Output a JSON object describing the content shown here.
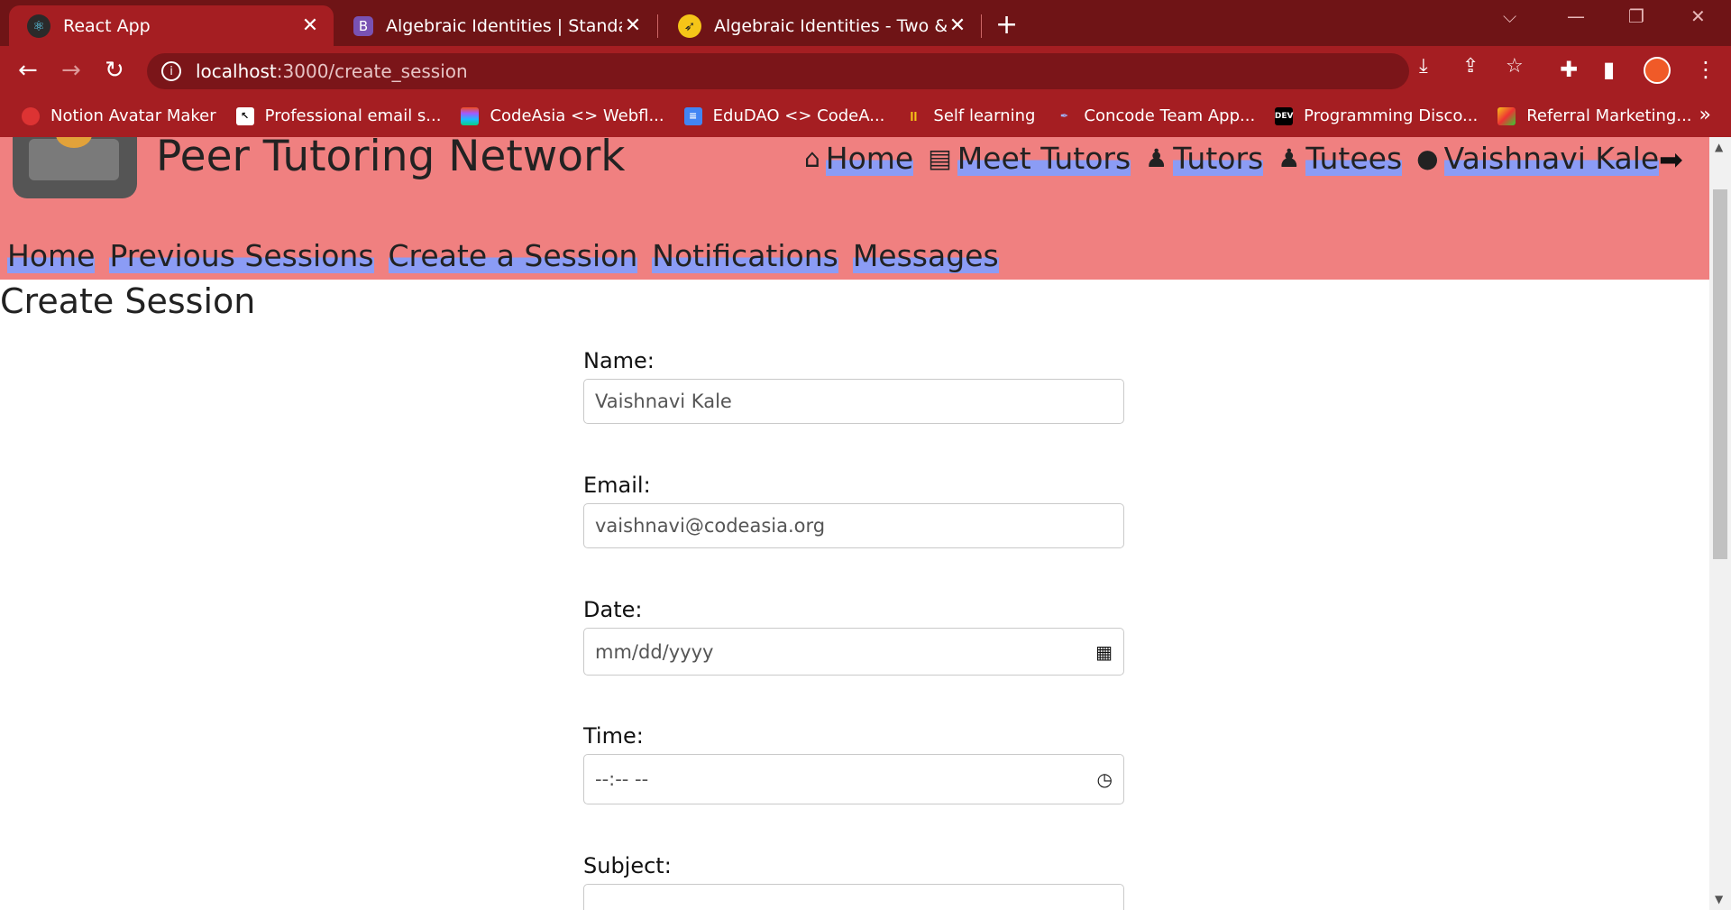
{
  "browser": {
    "tabs": [
      {
        "title": "React App",
        "icon": "react-icon",
        "active": true
      },
      {
        "title": "Algebraic Identities | Standard Al",
        "icon": "bootstrap-icon",
        "active": false
      },
      {
        "title": "Algebraic Identities - Two & Thre",
        "icon": "rocket-icon",
        "active": false
      }
    ],
    "url_host": "localhost",
    "url_path": ":3000/create_session",
    "bookmarks": [
      "Notion Avatar Maker",
      "Professional email s...",
      "CodeAsia <> Webfl...",
      "EduDAO <> CodeA...",
      "Self learning",
      "Concode Team App...",
      "Programming Disco...",
      "Referral Marketing..."
    ],
    "colors": {
      "chrome_dark": "#6f1416",
      "chrome": "#a51e22"
    }
  },
  "app": {
    "brand": "Peer Tutoring Network",
    "top_nav": [
      "Home",
      "Meet Tutors",
      "Tutors",
      "Tutees",
      "Vaishnavi Kale"
    ],
    "sub_nav": [
      "Home",
      "Previous Sessions",
      "Create a Session",
      "Notifications",
      "Messages"
    ],
    "header_color": "#f08080",
    "highlight_color": "#8b9cf5"
  },
  "form": {
    "title": "Create Session",
    "name": {
      "label": "Name:",
      "value": "Vaishnavi Kale"
    },
    "email": {
      "label": "Email:",
      "value": "vaishnavi@codeasia.org"
    },
    "date": {
      "label": "Date:",
      "placeholder": "mm/dd/yyyy"
    },
    "time": {
      "label": "Time:",
      "placeholder": "--:-- --"
    },
    "subject": {
      "label": "Subject:",
      "value": ""
    }
  }
}
